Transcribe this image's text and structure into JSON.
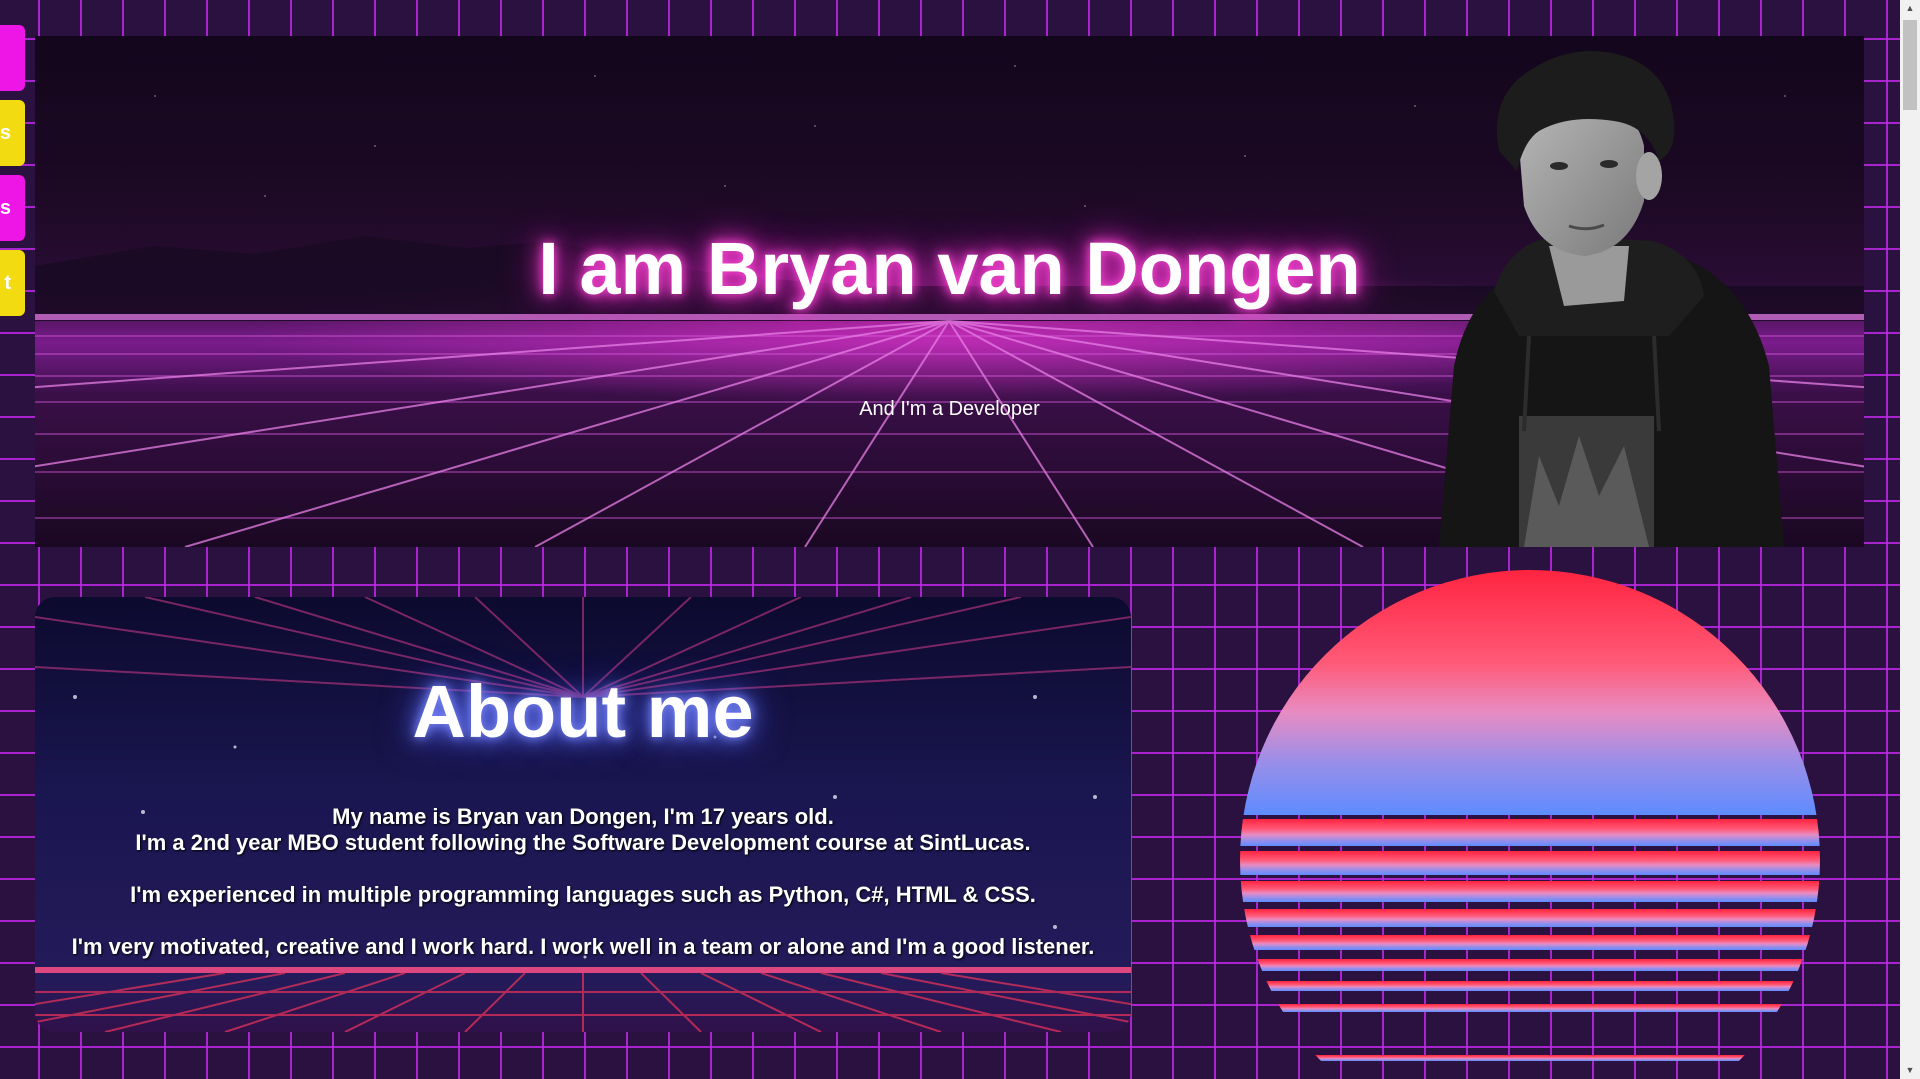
{
  "side_nav": {
    "items": [
      {
        "label": "",
        "color": "#ee16e6"
      },
      {
        "label": "s",
        "color": "#f3db12"
      },
      {
        "label": "s",
        "color": "#ee16e6"
      },
      {
        "label": "t",
        "color": "#f3db12"
      }
    ]
  },
  "hero": {
    "title": "I am Bryan van Dongen",
    "subtitle": "And I'm a Developer"
  },
  "about": {
    "title": "About me",
    "lines": [
      "My name is Bryan van Dongen, I'm 17 years old.",
      "I'm a 2nd year MBO student following the Software Development course at SintLucas.",
      "I'm experienced in multiple programming languages such as Python, C#, HTML & CSS.",
      "I'm very motivated, creative and I work hard. I work well in a team or alone and I'm a good listener."
    ]
  },
  "colors": {
    "grid": "#be28e6",
    "background": "#2a1140",
    "accent_magenta": "#ee16e6",
    "accent_yellow": "#f3db12",
    "sun_top": "#ff2a48",
    "sun_bottom": "#6a8cff"
  },
  "scrollbar": {
    "up_icon": "scroll-up-arrow-icon",
    "down_icon": "scroll-down-arrow-icon"
  }
}
